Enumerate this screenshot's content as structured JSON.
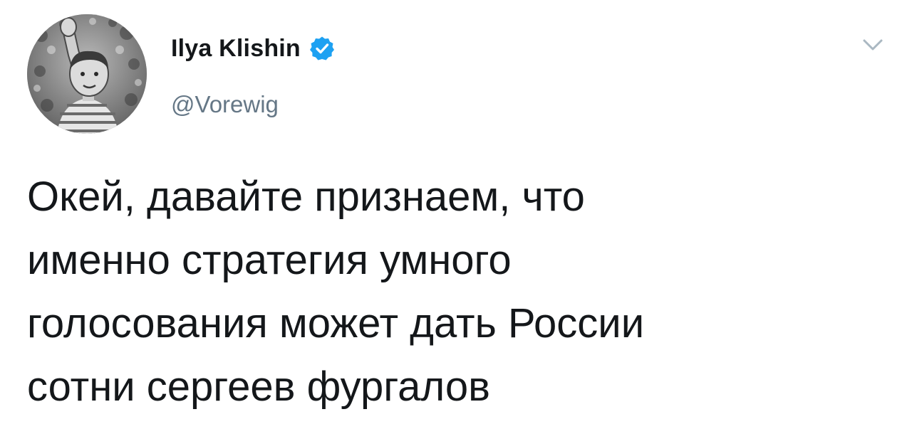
{
  "author": {
    "display_name": "Ilya Klishin",
    "handle": "@Vorewig",
    "verified": true,
    "avatar_icon": "avatar-photo-boy-waving"
  },
  "icons": {
    "verified": "verified-badge-icon",
    "menu": "chevron-down-icon"
  },
  "tweet": {
    "lines": [
      "Окей, давайте признаем, что",
      "именно стратегия умного",
      "голосования может дать России",
      "сотни сергеев фургалов"
    ]
  },
  "colors": {
    "text": "#14171a",
    "secondary_text": "#657786",
    "verified_badge": "#1da1f2",
    "caret": "#aab8c2"
  }
}
